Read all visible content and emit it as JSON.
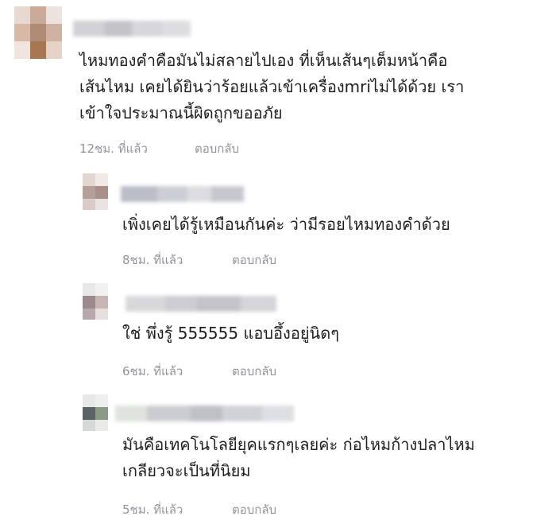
{
  "thread": {
    "main_comment": {
      "avatar": "blurred-avatar",
      "author_name": "",
      "text": "ไหมทองคำคือมันไม่สลายไปเอง ที่เห็นเส้นๆเต็มหน้าคือ\nเส้นไหม เคยได้ยินว่าร้อยแล้วเข้าเครื่องmriไม่ได้ด้วย เรา\nเข้าใจประมาณนี้ผิดถูกขออภัย",
      "time": "12ชม. ที่แล้ว",
      "reply_label": "ตอบกลับ"
    },
    "replies": [
      {
        "avatar": "blurred-avatar",
        "author_name": "",
        "text": "เพิ่งเคยได้รู้เหมือนกันค่ะ ว่ามีรอยไหมทองคำด้วย",
        "time": "8ชม. ที่แล้ว",
        "reply_label": "ตอบกลับ"
      },
      {
        "avatar": "blurred-avatar",
        "author_name": "",
        "text": "ใช่ พึ่งรู้ 555555 แอบอึ้งอยู่นิดๆ",
        "time": "6ชม. ที่แล้ว",
        "reply_label": "ตอบกลับ"
      },
      {
        "avatar": "blurred-avatar",
        "author_name": "",
        "text": "มันคือเทคโนโลยียุคแรกๆเลยค่ะ ก่อไหมก้างปลาไหม\nเกลียวจะเป็นที่นิยม",
        "time": "5ชม. ที่แล้ว",
        "reply_label": "ตอบกลับ"
      }
    ]
  },
  "colors": {
    "text": "#1c1e21",
    "meta": "#90949c",
    "background": "#ffffff"
  }
}
